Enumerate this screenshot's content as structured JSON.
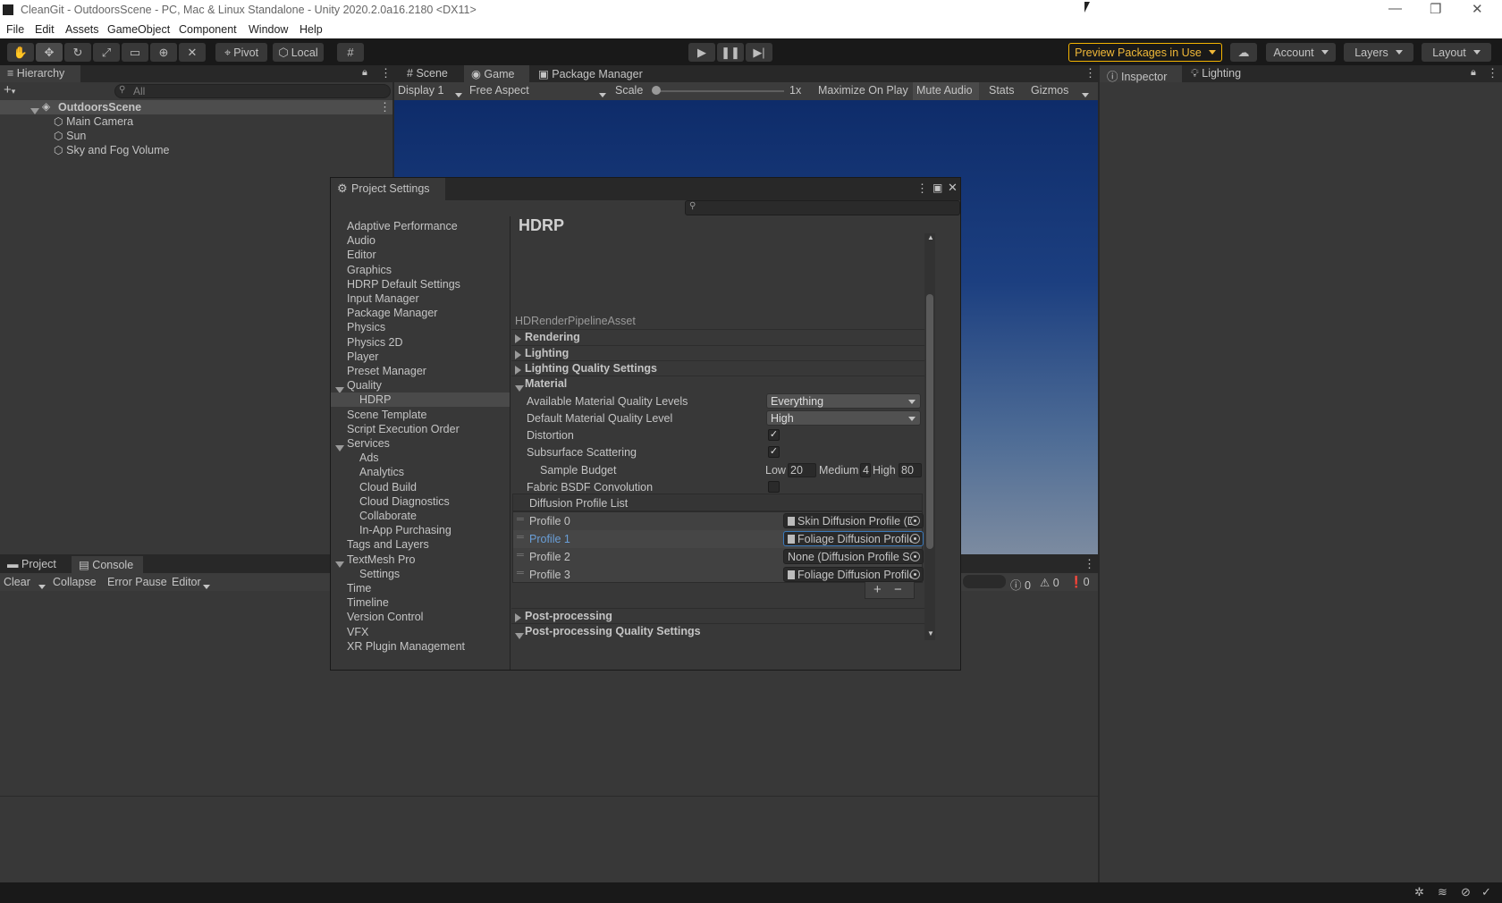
{
  "window": {
    "title": "CleanGit - OutdoorsScene - PC, Mac & Linux Standalone - Unity 2020.2.0a16.2180 <DX11>",
    "minimize": "—",
    "restore": "❐",
    "close": "✕"
  },
  "menu": [
    "File",
    "Edit",
    "Assets",
    "GameObject",
    "Component",
    "Window",
    "Help"
  ],
  "toolbar": {
    "pivot": "Pivot",
    "local": "Local",
    "preview_packages": "Preview Packages in Use",
    "account": "Account",
    "layers": "Layers",
    "layout": "Layout"
  },
  "hierarchy": {
    "tab": "Hierarchy",
    "search_placeholder": "All",
    "scene": "OutdoorsScene",
    "items": [
      "Main Camera",
      "Sun",
      "Sky and Fog Volume"
    ]
  },
  "center_tabs": {
    "scene": "Scene",
    "game": "Game",
    "package_manager": "Package Manager"
  },
  "game_bar": {
    "display": "Display 1",
    "aspect": "Free Aspect",
    "scale_label": "Scale",
    "scale_value": "1x",
    "scale_slider": 0,
    "maximize": "Maximize On Play",
    "mute": "Mute Audio",
    "stats": "Stats",
    "gizmos": "Gizmos"
  },
  "inspector_tabs": {
    "inspector": "Inspector",
    "lighting": "Lighting"
  },
  "bottom": {
    "project_tab": "Project",
    "console_tab": "Console",
    "clear": "Clear",
    "collapse": "Collapse",
    "error_pause": "Error Pause",
    "editor": "Editor",
    "counts": [
      "0",
      "0",
      "0"
    ]
  },
  "project_settings": {
    "title": "Project Settings",
    "nav": [
      {
        "label": "Adaptive Performance",
        "sub": false
      },
      {
        "label": "Audio",
        "sub": false
      },
      {
        "label": "Editor",
        "sub": false
      },
      {
        "label": "Graphics",
        "sub": false
      },
      {
        "label": "HDRP Default Settings",
        "sub": false
      },
      {
        "label": "Input Manager",
        "sub": false
      },
      {
        "label": "Package Manager",
        "sub": false
      },
      {
        "label": "Physics",
        "sub": false
      },
      {
        "label": "Physics 2D",
        "sub": false
      },
      {
        "label": "Player",
        "sub": false
      },
      {
        "label": "Preset Manager",
        "sub": false
      },
      {
        "label": "Quality",
        "sub": false,
        "expanded": true
      },
      {
        "label": "HDRP",
        "sub": true,
        "selected": true
      },
      {
        "label": "Scene Template",
        "sub": false
      },
      {
        "label": "Script Execution Order",
        "sub": false
      },
      {
        "label": "Services",
        "sub": false,
        "expanded": true
      },
      {
        "label": "Ads",
        "sub": true
      },
      {
        "label": "Analytics",
        "sub": true
      },
      {
        "label": "Cloud Build",
        "sub": true
      },
      {
        "label": "Cloud Diagnostics",
        "sub": true
      },
      {
        "label": "Collaborate",
        "sub": true
      },
      {
        "label": "In-App Purchasing",
        "sub": true
      },
      {
        "label": "Tags and Layers",
        "sub": false
      },
      {
        "label": "TextMesh Pro",
        "sub": false,
        "expanded": true
      },
      {
        "label": "Settings",
        "sub": true
      },
      {
        "label": "Time",
        "sub": false
      },
      {
        "label": "Timeline",
        "sub": false
      },
      {
        "label": "Version Control",
        "sub": false
      },
      {
        "label": "VFX",
        "sub": false
      },
      {
        "label": "XR Plugin Management",
        "sub": false
      }
    ],
    "heading": "HDRP",
    "asset_label": "HDRenderPipelineAsset",
    "sections": {
      "rendering": "Rendering",
      "lighting": "Lighting",
      "lighting_quality": "Lighting Quality Settings",
      "material": "Material",
      "post_processing": "Post-processing",
      "post_processing_quality": "Post-processing Quality Settings"
    },
    "material": {
      "available_levels_label": "Available Material Quality Levels",
      "available_levels_value": "Everything",
      "default_level_label": "Default Material Quality Level",
      "default_level_value": "High",
      "distortion_label": "Distortion",
      "distortion": true,
      "sss_label": "Subsurface Scattering",
      "sss": true,
      "sample_budget_label": "Sample Budget",
      "low_label": "Low",
      "low": "20",
      "medium_label": "Medium",
      "medium": "4",
      "high_label": "High",
      "high": "80",
      "fabric_label": "Fabric BSDF Convolution",
      "fabric": false
    },
    "diffusion": {
      "header": "Diffusion Profile List",
      "profiles": [
        {
          "name": "Profile 0",
          "value": "Skin Diffusion Profile (D",
          "icon": true
        },
        {
          "name": "Profile 1",
          "value": "Foliage Diffusion Profile",
          "icon": true,
          "selected": true
        },
        {
          "name": "Profile 2",
          "value": "None (Diffusion Profile Se",
          "icon": false
        },
        {
          "name": "Profile 3",
          "value": "Foliage Diffusion Profile",
          "icon": true
        }
      ],
      "add": "+",
      "remove": "−"
    }
  }
}
